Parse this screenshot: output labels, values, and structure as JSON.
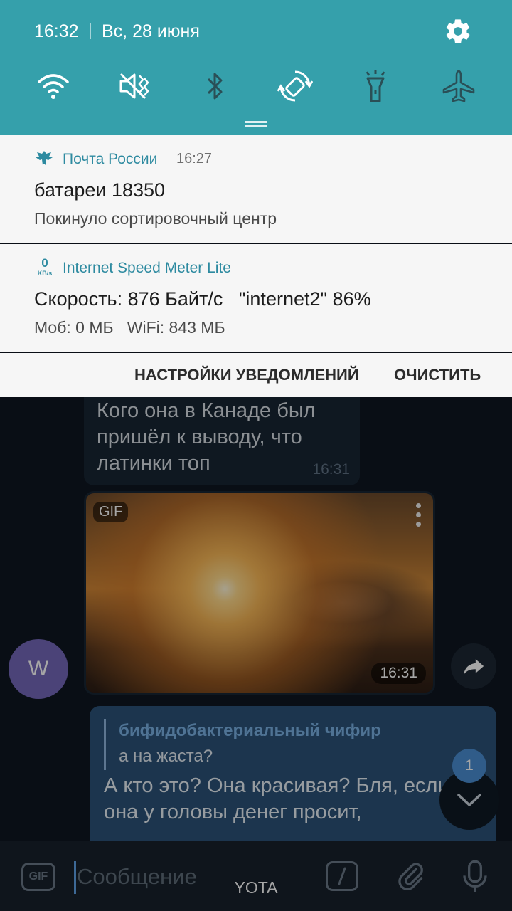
{
  "status_bar": {
    "time": "16:32",
    "date": "Вс, 28 июня",
    "settings_icon": "gear-icon"
  },
  "quick_settings": [
    {
      "name": "wifi",
      "icon": "wifi-icon",
      "active": true
    },
    {
      "name": "sound",
      "icon": "mute-icon",
      "active": true
    },
    {
      "name": "bluetooth",
      "icon": "bluetooth-icon",
      "active": false
    },
    {
      "name": "auto-rotate",
      "icon": "rotate-icon",
      "active": true
    },
    {
      "name": "flashlight",
      "icon": "flashlight-icon",
      "active": false
    },
    {
      "name": "airplane",
      "icon": "airplane-icon",
      "active": false
    }
  ],
  "notifications": [
    {
      "app": "Почта России",
      "time": "16:27",
      "title": "батареи 18350",
      "text": "Покинуло сортировочный центр"
    },
    {
      "app": "Internet Speed Meter Lite",
      "icon_value": "0",
      "icon_unit": "KB/s",
      "title": "Скорость: 876 Байт/с   \"internet2\" 86%",
      "text": "Моб: 0 МБ   WiFi: 843 МБ"
    }
  ],
  "notification_actions": {
    "settings": "НАСТРОЙКИ УВЕДОМЛЕНИЙ",
    "clear": "ОЧИСТИТЬ"
  },
  "chat": {
    "message1": {
      "text": "Кого она в Канаде был пришёл к выводу, что латинки топ",
      "time": "16:31"
    },
    "gif": {
      "label": "GIF",
      "time": "16:31"
    },
    "avatar_letter": "W",
    "reply": {
      "author": "бифидобактериальный чифир",
      "quoted": "а на жаста?",
      "text": "А кто это? Она красивая? Бля, если она у головы денег просит,"
    },
    "unread_count": "1",
    "input": {
      "gif_label": "GIF",
      "placeholder": "Сообщение"
    },
    "carrier": "YOTA"
  },
  "colors": {
    "shade": "#35a0ab",
    "chat_bg": "#0e1621",
    "outgoing_bubble": "#2b5278",
    "incoming_bubble": "#182533"
  }
}
